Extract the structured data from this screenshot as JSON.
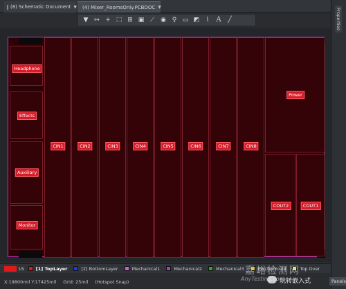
{
  "tabs": [
    {
      "label": "(8) Schematic Document"
    },
    {
      "label": "(4) Mixer_RoomsOnly.PCBDOC"
    }
  ],
  "side_panel": {
    "label": "Properties"
  },
  "toolbar": {
    "icons": [
      "filter-icon",
      "route-icon",
      "place-component-icon",
      "select-rect-icon",
      "align-icon",
      "place-pad-icon",
      "wire-icon",
      "via-icon",
      "tip-icon",
      "fill-icon",
      "region-icon",
      "dimension-icon",
      "text-icon",
      "line-icon"
    ]
  },
  "rooms": [
    {
      "label": "Headphone"
    },
    {
      "label": "Effects"
    },
    {
      "label": "Auxiliary"
    },
    {
      "label": "Monitor"
    },
    {
      "label": "CIN1"
    },
    {
      "label": "CIN2"
    },
    {
      "label": "CIN3"
    },
    {
      "label": "CIN4"
    },
    {
      "label": "CIN5"
    },
    {
      "label": "CIN6"
    },
    {
      "label": "CIN7"
    },
    {
      "label": "CIN8"
    },
    {
      "label": "Power"
    },
    {
      "label": "COUT2"
    },
    {
      "label": "COUT1"
    }
  ],
  "layer_bar": {
    "ls_label": "LS",
    "layers": [
      {
        "label": "[1] TopLayer",
        "color": "#e01a1a",
        "active": true
      },
      {
        "label": "[2] BottomLayer",
        "color": "#1a3fe0",
        "active": false
      },
      {
        "label": "Mechanical1",
        "color": "#d060d0",
        "active": false
      },
      {
        "label": "Mechanical2",
        "color": "#a040c0",
        "active": false
      },
      {
        "label": "Mechanical3",
        "color": "#30a030",
        "active": false
      },
      {
        "label": "Mechanical4",
        "color": "#d0c020",
        "active": false
      },
      {
        "label": "Top Over",
        "color": "#e0e040",
        "active": false
      }
    ]
  },
  "status": {
    "coords": "X:19800mil Y:17425mil",
    "grid": "Grid: 25mil",
    "snap": "(Hotspot Snap)",
    "panels": "Panels"
  },
  "watermark": {
    "title": "嘉峪检测网",
    "subtitle": "AnyTesting.com",
    "brand": "玩转嵌入式"
  },
  "colors": {
    "board_fill": "#2b0306",
    "board_outline": "#c43fc4",
    "room_border": "#7a1e2a",
    "label_fill": "#d61c28"
  }
}
